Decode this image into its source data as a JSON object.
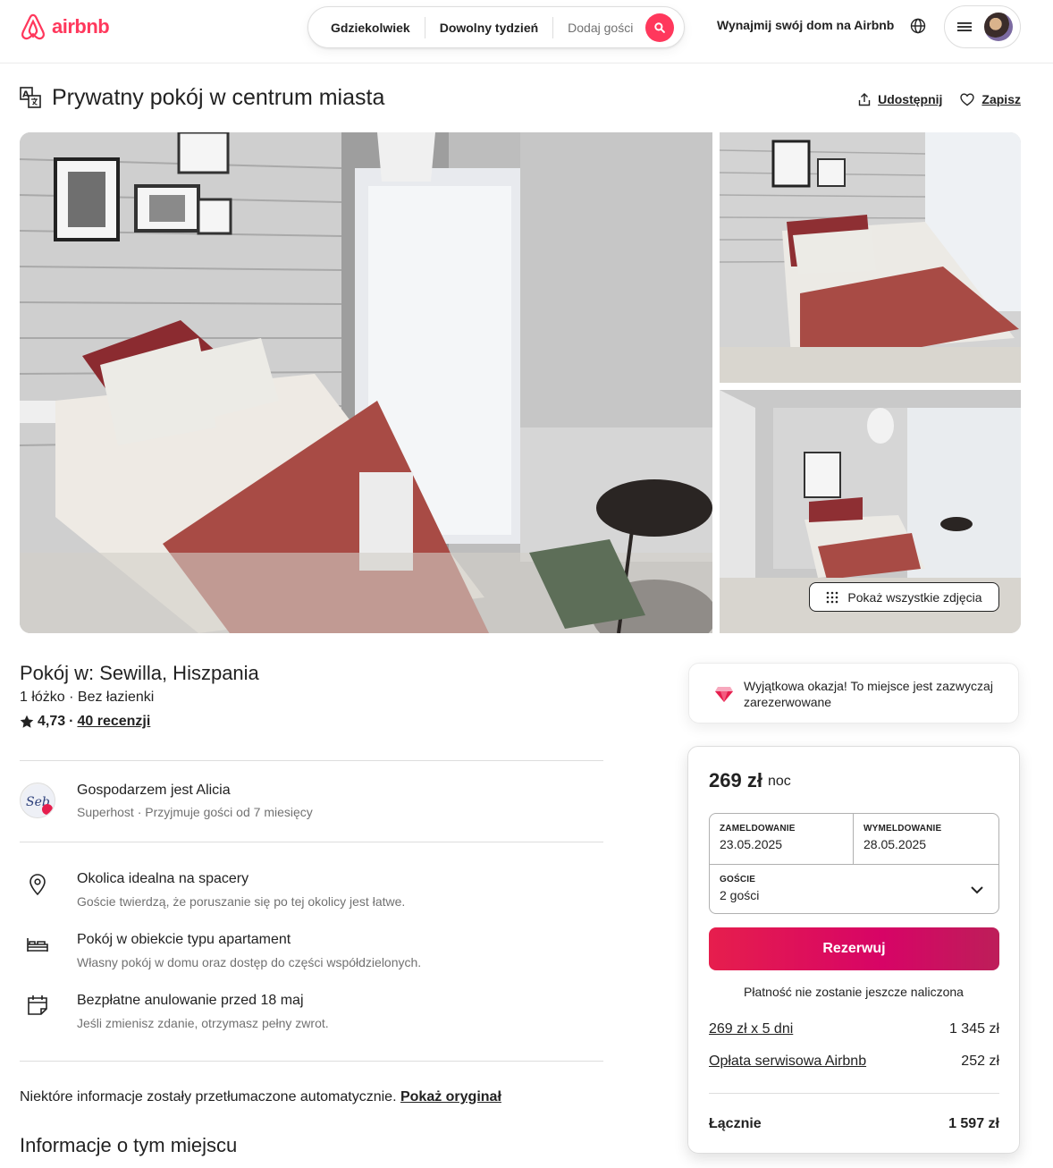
{
  "header": {
    "brand": "airbnb",
    "search": {
      "where": "Gdziekolwiek",
      "when": "Dowolny tydzień",
      "guests_placeholder": "Dodaj gości"
    },
    "host_link": "Wynajmij swój dom na Airbnb"
  },
  "listing": {
    "title": "Prywatny pokój w centrum miasta",
    "share_label": "Udostępnij",
    "save_label": "Zapisz",
    "show_all_photos": "Pokaż wszystkie zdjęcia",
    "location_title": "Pokój w: Sewilla, Hiszpania",
    "summary": "1 łóżko · Bez łazienki",
    "rating": "4,73",
    "rating_sep": "·",
    "reviews": "40 recenzji"
  },
  "host": {
    "name": "Gospodarzem jest Alicia",
    "subtitle": "Superhost · Przyjmuje gości od 7 miesięcy"
  },
  "features": [
    {
      "icon": "map-pin-icon",
      "title": "Okolica idealna na spacery",
      "subtitle": "Goście twierdzą, że poruszanie się po tej okolicy jest łatwe."
    },
    {
      "icon": "bed-icon",
      "title": "Pokój w obiekcie typu apartament",
      "subtitle": "Własny pokój w domu oraz dostęp do części współdzielonych."
    },
    {
      "icon": "calendar-icon",
      "title": "Bezpłatne anulowanie przed 18 maj",
      "subtitle": "Jeśli zmienisz zdanie, otrzymasz pełny zwrot."
    }
  ],
  "translation_note": {
    "text": "Niektóre informacje zostały przetłumaczone automatycznie.",
    "link": "Pokaż oryginał"
  },
  "about_title": "Informacje o tym miejscu",
  "rare_find": {
    "text": "Wyjątkowa okazja! To miejsce jest zazwyczaj zarezerwowane"
  },
  "booking": {
    "price": "269 zł",
    "per": "noc",
    "checkin_label": "ZAMELDOWANIE",
    "checkin_value": "23.05.2025",
    "checkout_label": "WYMELDOWANIE",
    "checkout_value": "28.05.2025",
    "guests_label": "GOŚCIE",
    "guests_value": "2 gości",
    "reserve_label": "Rezerwuj",
    "no_charge": "Płatność nie zostanie jeszcze naliczona",
    "nightly_label": "269 zł x 5 dni",
    "nightly_value": "1 345 zł",
    "fee_label": "Opłata serwisowa Airbnb",
    "fee_value": "252 zł",
    "total_label": "Łącznie",
    "total_value": "1 597 zł"
  },
  "colors": {
    "brand": "#ff385c",
    "reserve_start": "#e61e4d",
    "reserve_end": "#bd1e59",
    "muted_text": "#717171"
  }
}
